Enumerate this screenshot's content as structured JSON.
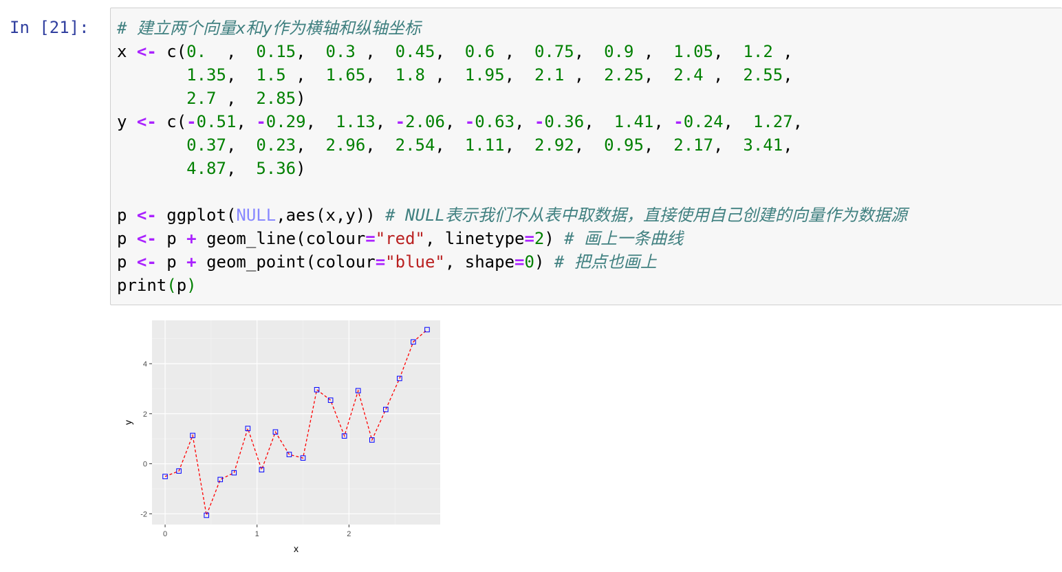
{
  "cell": {
    "prompt": "In [21]:",
    "code_lines": [
      [
        {
          "t": "# 建立两个向量x和y作为横轴和纵轴坐标",
          "c": "cm"
        }
      ],
      [
        {
          "t": "x ",
          "c": ""
        },
        {
          "t": "<-",
          "c": "op"
        },
        {
          "t": " c(",
          "c": ""
        },
        {
          "t": "0.",
          "c": "num"
        },
        {
          "t": "  ,  ",
          "c": ""
        },
        {
          "t": "0.15",
          "c": "num"
        },
        {
          "t": ",  ",
          "c": ""
        },
        {
          "t": "0.3",
          "c": "num"
        },
        {
          "t": " ,  ",
          "c": ""
        },
        {
          "t": "0.45",
          "c": "num"
        },
        {
          "t": ",  ",
          "c": ""
        },
        {
          "t": "0.6",
          "c": "num"
        },
        {
          "t": " ,  ",
          "c": ""
        },
        {
          "t": "0.75",
          "c": "num"
        },
        {
          "t": ",  ",
          "c": ""
        },
        {
          "t": "0.9",
          "c": "num"
        },
        {
          "t": " ,  ",
          "c": ""
        },
        {
          "t": "1.05",
          "c": "num"
        },
        {
          "t": ",  ",
          "c": ""
        },
        {
          "t": "1.2",
          "c": "num"
        },
        {
          "t": " ,",
          "c": ""
        }
      ],
      [
        {
          "t": "       ",
          "c": ""
        },
        {
          "t": "1.35",
          "c": "num"
        },
        {
          "t": ",  ",
          "c": ""
        },
        {
          "t": "1.5",
          "c": "num"
        },
        {
          "t": " ,  ",
          "c": ""
        },
        {
          "t": "1.65",
          "c": "num"
        },
        {
          "t": ",  ",
          "c": ""
        },
        {
          "t": "1.8",
          "c": "num"
        },
        {
          "t": " ,  ",
          "c": ""
        },
        {
          "t": "1.95",
          "c": "num"
        },
        {
          "t": ",  ",
          "c": ""
        },
        {
          "t": "2.1",
          "c": "num"
        },
        {
          "t": " ,  ",
          "c": ""
        },
        {
          "t": "2.25",
          "c": "num"
        },
        {
          "t": ",  ",
          "c": ""
        },
        {
          "t": "2.4",
          "c": "num"
        },
        {
          "t": " ,  ",
          "c": ""
        },
        {
          "t": "2.55",
          "c": "num"
        },
        {
          "t": ",",
          "c": ""
        }
      ],
      [
        {
          "t": "       ",
          "c": ""
        },
        {
          "t": "2.7",
          "c": "num"
        },
        {
          "t": " ,  ",
          "c": ""
        },
        {
          "t": "2.85",
          "c": "num"
        },
        {
          "t": ")",
          "c": ""
        }
      ],
      [
        {
          "t": "y ",
          "c": ""
        },
        {
          "t": "<-",
          "c": "op"
        },
        {
          "t": " c(",
          "c": ""
        },
        {
          "t": "-",
          "c": "op"
        },
        {
          "t": "0.51",
          "c": "num"
        },
        {
          "t": ", ",
          "c": ""
        },
        {
          "t": "-",
          "c": "op"
        },
        {
          "t": "0.29",
          "c": "num"
        },
        {
          "t": ",  ",
          "c": ""
        },
        {
          "t": "1.13",
          "c": "num"
        },
        {
          "t": ", ",
          "c": ""
        },
        {
          "t": "-",
          "c": "op"
        },
        {
          "t": "2.06",
          "c": "num"
        },
        {
          "t": ", ",
          "c": ""
        },
        {
          "t": "-",
          "c": "op"
        },
        {
          "t": "0.63",
          "c": "num"
        },
        {
          "t": ", ",
          "c": ""
        },
        {
          "t": "-",
          "c": "op"
        },
        {
          "t": "0.36",
          "c": "num"
        },
        {
          "t": ",  ",
          "c": ""
        },
        {
          "t": "1.41",
          "c": "num"
        },
        {
          "t": ", ",
          "c": ""
        },
        {
          "t": "-",
          "c": "op"
        },
        {
          "t": "0.24",
          "c": "num"
        },
        {
          "t": ",  ",
          "c": ""
        },
        {
          "t": "1.27",
          "c": "num"
        },
        {
          "t": ",",
          "c": ""
        }
      ],
      [
        {
          "t": "       ",
          "c": ""
        },
        {
          "t": "0.37",
          "c": "num"
        },
        {
          "t": ",  ",
          "c": ""
        },
        {
          "t": "0.23",
          "c": "num"
        },
        {
          "t": ",  ",
          "c": ""
        },
        {
          "t": "2.96",
          "c": "num"
        },
        {
          "t": ",  ",
          "c": ""
        },
        {
          "t": "2.54",
          "c": "num"
        },
        {
          "t": ",  ",
          "c": ""
        },
        {
          "t": "1.11",
          "c": "num"
        },
        {
          "t": ",  ",
          "c": ""
        },
        {
          "t": "2.92",
          "c": "num"
        },
        {
          "t": ",  ",
          "c": ""
        },
        {
          "t": "0.95",
          "c": "num"
        },
        {
          "t": ",  ",
          "c": ""
        },
        {
          "t": "2.17",
          "c": "num"
        },
        {
          "t": ",  ",
          "c": ""
        },
        {
          "t": "3.41",
          "c": "num"
        },
        {
          "t": ",",
          "c": ""
        }
      ],
      [
        {
          "t": "       ",
          "c": ""
        },
        {
          "t": "4.87",
          "c": "num"
        },
        {
          "t": ",  ",
          "c": ""
        },
        {
          "t": "5.36",
          "c": "num"
        },
        {
          "t": ")",
          "c": ""
        }
      ],
      [
        {
          "t": "",
          "c": ""
        }
      ],
      [
        {
          "t": "p ",
          "c": ""
        },
        {
          "t": "<-",
          "c": "op"
        },
        {
          "t": " ggplot(",
          "c": ""
        },
        {
          "t": "NULL",
          "c": "nul"
        },
        {
          "t": ",aes(x,y)) ",
          "c": ""
        },
        {
          "t": "# NULL表示我们不从表中取数据，直接使用自己创建的向量作为数据源",
          "c": "cm"
        }
      ],
      [
        {
          "t": "p ",
          "c": ""
        },
        {
          "t": "<-",
          "c": "op"
        },
        {
          "t": " p ",
          "c": ""
        },
        {
          "t": "+",
          "c": "op"
        },
        {
          "t": " geom_line(colour",
          "c": ""
        },
        {
          "t": "=",
          "c": "op"
        },
        {
          "t": "\"red\"",
          "c": "str"
        },
        {
          "t": ", linetype",
          "c": ""
        },
        {
          "t": "=",
          "c": "op"
        },
        {
          "t": "2",
          "c": "num"
        },
        {
          "t": ") ",
          "c": ""
        },
        {
          "t": "# 画上一条曲线",
          "c": "cm"
        }
      ],
      [
        {
          "t": "p ",
          "c": ""
        },
        {
          "t": "<-",
          "c": "op"
        },
        {
          "t": " p ",
          "c": ""
        },
        {
          "t": "+",
          "c": "op"
        },
        {
          "t": " geom_point(colour",
          "c": ""
        },
        {
          "t": "=",
          "c": "op"
        },
        {
          "t": "\"blue\"",
          "c": "str"
        },
        {
          "t": ", shape",
          "c": ""
        },
        {
          "t": "=",
          "c": "op"
        },
        {
          "t": "0",
          "c": "num"
        },
        {
          "t": ") ",
          "c": ""
        },
        {
          "t": "# 把点也画上",
          "c": "cm"
        }
      ],
      [
        {
          "t": "print",
          "c": ""
        },
        {
          "t": "(",
          "c": "kw"
        },
        {
          "t": "p",
          "c": ""
        },
        {
          "t": ")",
          "c": "kw"
        }
      ]
    ]
  },
  "chart_data": {
    "type": "line",
    "x": [
      0.0,
      0.15,
      0.3,
      0.45,
      0.6,
      0.75,
      0.9,
      1.05,
      1.2,
      1.35,
      1.5,
      1.65,
      1.8,
      1.95,
      2.1,
      2.25,
      2.4,
      2.55,
      2.7,
      2.85
    ],
    "y": [
      -0.51,
      -0.29,
      1.13,
      -2.06,
      -0.63,
      -0.36,
      1.41,
      -0.24,
      1.27,
      0.37,
      0.23,
      2.96,
      2.54,
      1.11,
      2.92,
      0.95,
      2.17,
      3.41,
      4.87,
      5.36
    ],
    "xlabel": "x",
    "ylabel": "y",
    "xticks": [
      "0",
      "1",
      "2"
    ],
    "yticks": [
      "-2",
      "0",
      "2",
      "4"
    ],
    "xlim": [
      -0.1425,
      2.9925
    ],
    "ylim": [
      -2.431,
      5.731
    ],
    "line_color": "#ff0000",
    "line_style": "dashed",
    "point_color": "#0000ff",
    "point_shape": "open-square",
    "panel_bg": "#ebebeb",
    "grid": true
  }
}
